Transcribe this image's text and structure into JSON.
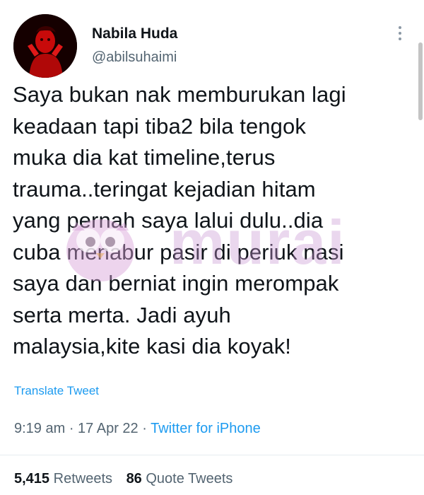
{
  "user": {
    "display_name": "Nabila Huda",
    "handle": "@abilsuhaimi"
  },
  "tweet": {
    "text": "Saya bukan nak memburukan lagi\nkeadaan tapi tiba2 bila tengok\nmuka dia kat timeline,terus\ntrauma..teringat kejadian hitam\nyang pernah saya lalui dulu..dia\ncuba menabur pasir di periuk nasi\nsaya dan berniat ingin merompak\nserta merta. Jadi ayuh\nmalaysia,kite kasi dia koyak!",
    "translate_label": "Translate Tweet"
  },
  "meta": {
    "time": "9:19 am",
    "separator1": " · ",
    "date": "17 Apr 22",
    "separator2": " · ",
    "source": "Twitter for iPhone"
  },
  "stats": {
    "retweets_count": "5,415",
    "retweets_label": "Retweets",
    "quote_count": "86",
    "quote_label": "Quote Tweets"
  },
  "watermark": {
    "text": "murai"
  },
  "colors": {
    "link": "#1d9bf0",
    "secondary": "#536471",
    "primary": "#0f1419"
  },
  "icons": {
    "more": "more-options-icon",
    "avatar": "profile-avatar"
  }
}
